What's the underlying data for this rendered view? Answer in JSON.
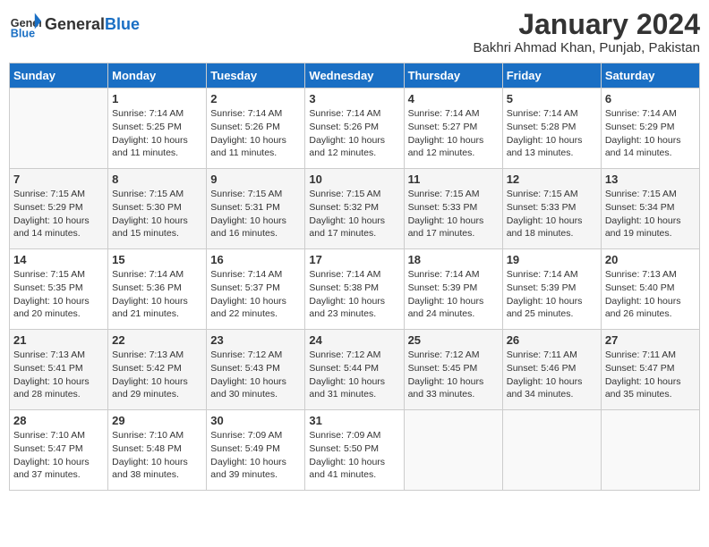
{
  "header": {
    "logo_general": "General",
    "logo_blue": "Blue",
    "month_title": "January 2024",
    "location": "Bakhri Ahmad Khan, Punjab, Pakistan"
  },
  "days_of_week": [
    "Sunday",
    "Monday",
    "Tuesday",
    "Wednesday",
    "Thursday",
    "Friday",
    "Saturday"
  ],
  "weeks": [
    [
      {
        "num": "",
        "info": ""
      },
      {
        "num": "1",
        "info": "Sunrise: 7:14 AM\nSunset: 5:25 PM\nDaylight: 10 hours\nand 11 minutes."
      },
      {
        "num": "2",
        "info": "Sunrise: 7:14 AM\nSunset: 5:26 PM\nDaylight: 10 hours\nand 11 minutes."
      },
      {
        "num": "3",
        "info": "Sunrise: 7:14 AM\nSunset: 5:26 PM\nDaylight: 10 hours\nand 12 minutes."
      },
      {
        "num": "4",
        "info": "Sunrise: 7:14 AM\nSunset: 5:27 PM\nDaylight: 10 hours\nand 12 minutes."
      },
      {
        "num": "5",
        "info": "Sunrise: 7:14 AM\nSunset: 5:28 PM\nDaylight: 10 hours\nand 13 minutes."
      },
      {
        "num": "6",
        "info": "Sunrise: 7:14 AM\nSunset: 5:29 PM\nDaylight: 10 hours\nand 14 minutes."
      }
    ],
    [
      {
        "num": "7",
        "info": "Sunrise: 7:15 AM\nSunset: 5:29 PM\nDaylight: 10 hours\nand 14 minutes."
      },
      {
        "num": "8",
        "info": "Sunrise: 7:15 AM\nSunset: 5:30 PM\nDaylight: 10 hours\nand 15 minutes."
      },
      {
        "num": "9",
        "info": "Sunrise: 7:15 AM\nSunset: 5:31 PM\nDaylight: 10 hours\nand 16 minutes."
      },
      {
        "num": "10",
        "info": "Sunrise: 7:15 AM\nSunset: 5:32 PM\nDaylight: 10 hours\nand 17 minutes."
      },
      {
        "num": "11",
        "info": "Sunrise: 7:15 AM\nSunset: 5:33 PM\nDaylight: 10 hours\nand 17 minutes."
      },
      {
        "num": "12",
        "info": "Sunrise: 7:15 AM\nSunset: 5:33 PM\nDaylight: 10 hours\nand 18 minutes."
      },
      {
        "num": "13",
        "info": "Sunrise: 7:15 AM\nSunset: 5:34 PM\nDaylight: 10 hours\nand 19 minutes."
      }
    ],
    [
      {
        "num": "14",
        "info": "Sunrise: 7:15 AM\nSunset: 5:35 PM\nDaylight: 10 hours\nand 20 minutes."
      },
      {
        "num": "15",
        "info": "Sunrise: 7:14 AM\nSunset: 5:36 PM\nDaylight: 10 hours\nand 21 minutes."
      },
      {
        "num": "16",
        "info": "Sunrise: 7:14 AM\nSunset: 5:37 PM\nDaylight: 10 hours\nand 22 minutes."
      },
      {
        "num": "17",
        "info": "Sunrise: 7:14 AM\nSunset: 5:38 PM\nDaylight: 10 hours\nand 23 minutes."
      },
      {
        "num": "18",
        "info": "Sunrise: 7:14 AM\nSunset: 5:39 PM\nDaylight: 10 hours\nand 24 minutes."
      },
      {
        "num": "19",
        "info": "Sunrise: 7:14 AM\nSunset: 5:39 PM\nDaylight: 10 hours\nand 25 minutes."
      },
      {
        "num": "20",
        "info": "Sunrise: 7:13 AM\nSunset: 5:40 PM\nDaylight: 10 hours\nand 26 minutes."
      }
    ],
    [
      {
        "num": "21",
        "info": "Sunrise: 7:13 AM\nSunset: 5:41 PM\nDaylight: 10 hours\nand 28 minutes."
      },
      {
        "num": "22",
        "info": "Sunrise: 7:13 AM\nSunset: 5:42 PM\nDaylight: 10 hours\nand 29 minutes."
      },
      {
        "num": "23",
        "info": "Sunrise: 7:12 AM\nSunset: 5:43 PM\nDaylight: 10 hours\nand 30 minutes."
      },
      {
        "num": "24",
        "info": "Sunrise: 7:12 AM\nSunset: 5:44 PM\nDaylight: 10 hours\nand 31 minutes."
      },
      {
        "num": "25",
        "info": "Sunrise: 7:12 AM\nSunset: 5:45 PM\nDaylight: 10 hours\nand 33 minutes."
      },
      {
        "num": "26",
        "info": "Sunrise: 7:11 AM\nSunset: 5:46 PM\nDaylight: 10 hours\nand 34 minutes."
      },
      {
        "num": "27",
        "info": "Sunrise: 7:11 AM\nSunset: 5:47 PM\nDaylight: 10 hours\nand 35 minutes."
      }
    ],
    [
      {
        "num": "28",
        "info": "Sunrise: 7:10 AM\nSunset: 5:47 PM\nDaylight: 10 hours\nand 37 minutes."
      },
      {
        "num": "29",
        "info": "Sunrise: 7:10 AM\nSunset: 5:48 PM\nDaylight: 10 hours\nand 38 minutes."
      },
      {
        "num": "30",
        "info": "Sunrise: 7:09 AM\nSunset: 5:49 PM\nDaylight: 10 hours\nand 39 minutes."
      },
      {
        "num": "31",
        "info": "Sunrise: 7:09 AM\nSunset: 5:50 PM\nDaylight: 10 hours\nand 41 minutes."
      },
      {
        "num": "",
        "info": ""
      },
      {
        "num": "",
        "info": ""
      },
      {
        "num": "",
        "info": ""
      }
    ]
  ]
}
